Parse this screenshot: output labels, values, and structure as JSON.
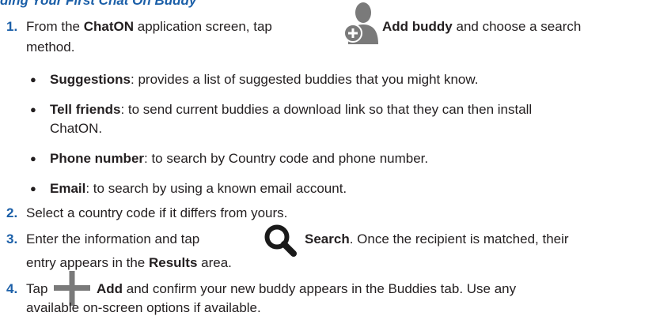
{
  "heading": "ding Your First Chat On Buddy",
  "steps": [
    {
      "number": "1.",
      "pre": "From the ",
      "app": "ChatON",
      "mid": " application screen, tap",
      "action": "Add buddy",
      "post": " and choose a search",
      "cont": "method."
    },
    {
      "number": "2.",
      "text": "Select a country code if it differs from yours."
    },
    {
      "number": "3.",
      "pre": "Enter the information and tap",
      "action": "Search",
      "post": ". Once the recipient is matched, their",
      "cont_pre": "entry appears in the ",
      "cont_bold": "Results",
      "cont_post": " area."
    },
    {
      "number": "4.",
      "pre": "Tap",
      "action": "Add",
      "post": " and confirm your new buddy appears in the Buddies tab. Use any",
      "cont": "available on-screen options if available."
    }
  ],
  "bullets": [
    {
      "term": "Suggestions",
      "text": ": provides a list of suggested buddies that you might know."
    },
    {
      "term": "Tell friends",
      "text": ": to send current buddies a download link so that they can then install",
      "cont": "ChatON."
    },
    {
      "term": "Phone number",
      "text": ": to search by Country code and phone number."
    },
    {
      "term": "Email",
      "text": ": to search by using a known email account."
    }
  ],
  "icons": {
    "add_buddy": "add-buddy-icon",
    "search": "magnifier-search-icon",
    "add": "plus-add-icon"
  },
  "colors": {
    "heading": "#1b5fa8",
    "icon_gray": "#7a7a7a",
    "body_text": "#231f20"
  }
}
